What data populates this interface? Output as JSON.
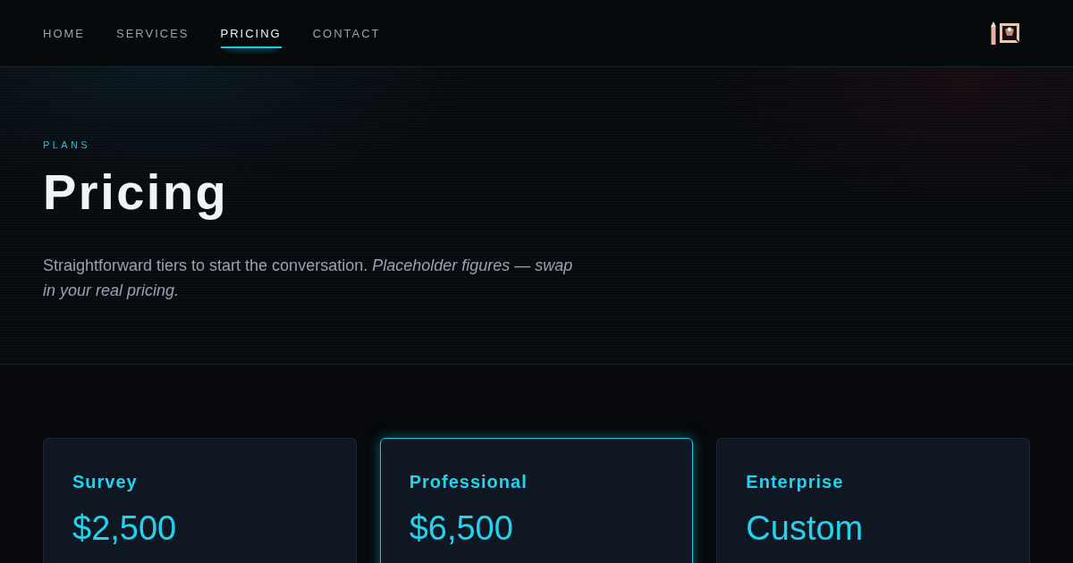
{
  "nav": {
    "items": [
      {
        "label": "HOME",
        "selected": false
      },
      {
        "label": "SERVICES",
        "selected": false
      },
      {
        "label": "PRICING",
        "selected": true
      },
      {
        "label": "CONTACT",
        "selected": false
      }
    ]
  },
  "hero": {
    "eyebrow": "PLANS",
    "title": "Pricing",
    "description": "Straightforward tiers to start the conversation. *Placeholder figures — swap in your real pricing.*"
  },
  "plans": [
    {
      "name": "Survey",
      "price": "$2,500",
      "featured": false
    },
    {
      "name": "Professional",
      "price": "$6,500",
      "featured": true
    },
    {
      "name": "Enterprise",
      "price": "Custom",
      "featured": false
    }
  ]
}
